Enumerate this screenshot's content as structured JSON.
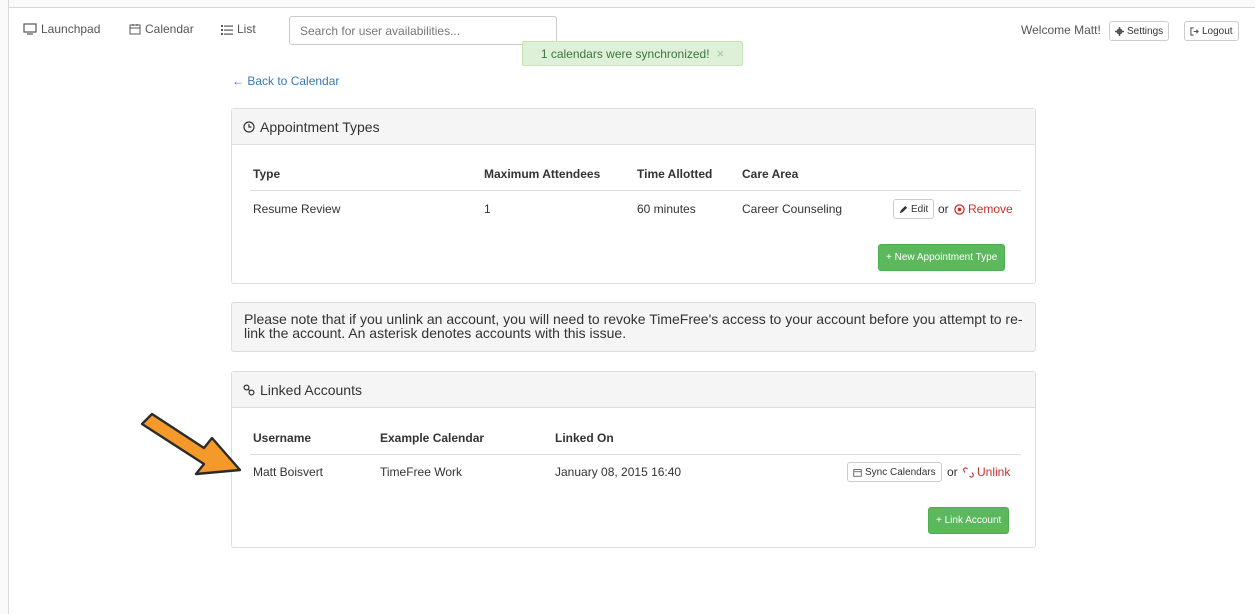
{
  "nav": {
    "launchpad": "Launchpad",
    "calendar": "Calendar",
    "list": "List",
    "search_placeholder": "Search for user availabilities...",
    "welcome": "Welcome Matt!",
    "settings": "Settings",
    "logout": "Logout"
  },
  "alert": {
    "message": "1 calendars were synchronized!",
    "close": "×"
  },
  "back_link": "← Back to Calendar",
  "appointment_types": {
    "title": "Appointment Types",
    "headers": [
      "Type",
      "Maximum Attendees",
      "Time Allotted",
      "Care Area"
    ],
    "rows": [
      {
        "type": "Resume Review",
        "max_attendees": "1",
        "time_allotted": "60 minutes",
        "care_area": "Career Counseling"
      }
    ],
    "edit_label": "Edit",
    "or_label": "or",
    "remove_label": "Remove",
    "new_button": "+ New Appointment Type"
  },
  "note": "Please note that if you unlink an account, you will need to revoke TimeFree's access to your account before you attempt to re-link the account. An asterisk denotes accounts with this issue.",
  "linked_accounts": {
    "title": "Linked Accounts",
    "headers": [
      "Username",
      "Example Calendar",
      "Linked On"
    ],
    "rows": [
      {
        "username": "Matt Boisvert",
        "calendar": "TimeFree Work",
        "linked_on": "January 08, 2015 16:40"
      }
    ],
    "sync_label": "Sync Calendars",
    "or_label": "or",
    "unlink_label": "Unlink",
    "link_button": "+ Link Account"
  },
  "colors": {
    "link": "#337ab7",
    "danger": "#c9302c",
    "success": "#5cb85c",
    "alert_bg": "#dff0d8",
    "arrow": "#f39a2b"
  }
}
